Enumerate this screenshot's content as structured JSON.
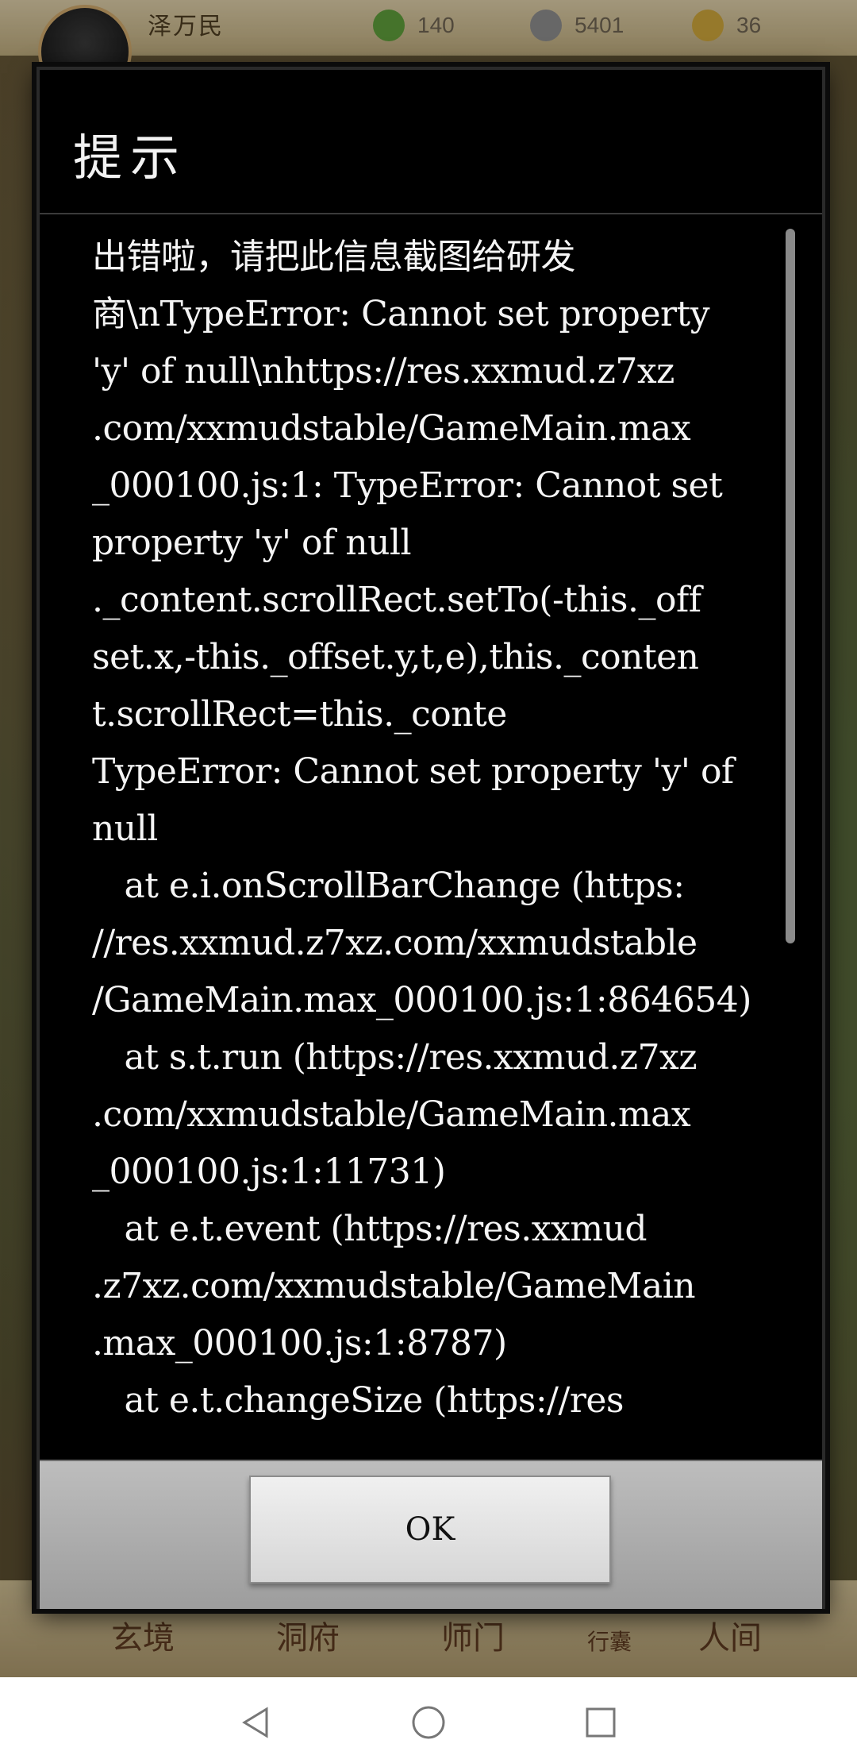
{
  "game": {
    "player_name": "泽万民",
    "resources": [
      {
        "name": "jade",
        "icon": "jade-icon",
        "value": "140"
      },
      {
        "name": "coin",
        "icon": "coin-icon",
        "value": "5401"
      },
      {
        "name": "gold",
        "icon": "gold-icon",
        "value": "36"
      }
    ],
    "bottom_nav": [
      "玄境",
      "洞府",
      "师门",
      "行囊",
      "人间"
    ]
  },
  "dialog": {
    "title": "提示",
    "message_lines": [
      "出错啦，请把此信息截图给研发",
      "商\\nTypeError: Cannot set property",
      "'y' of null\\nhttps://res.xxmud.z7xz",
      ".com/xxmudstable/GameMain.max",
      "_000100.js:1: TypeError: Cannot set",
      "property 'y' of null",
      "._content.scrollRect.setTo(-this._off",
      "set.x,-this._offset.y,t,e),this._conten",
      "t.scrollRect=this._conte",
      "TypeError: Cannot set property 'y' of",
      "null",
      "   at e.i.onScrollBarChange (https:",
      "//res.xxmud.z7xz.com/xxmudstable",
      "/GameMain.max_000100.js:1:864654)",
      "   at s.t.run (https://res.xxmud.z7xz",
      ".com/xxmudstable/GameMain.max",
      "_000100.js:1:11731)",
      "   at e.t.event (https://res.xxmud",
      ".z7xz.com/xxmudstable/GameMain",
      ".max_000100.js:1:8787)",
      "   at e.t.changeSize (https://res"
    ],
    "ok_label": "OK"
  }
}
